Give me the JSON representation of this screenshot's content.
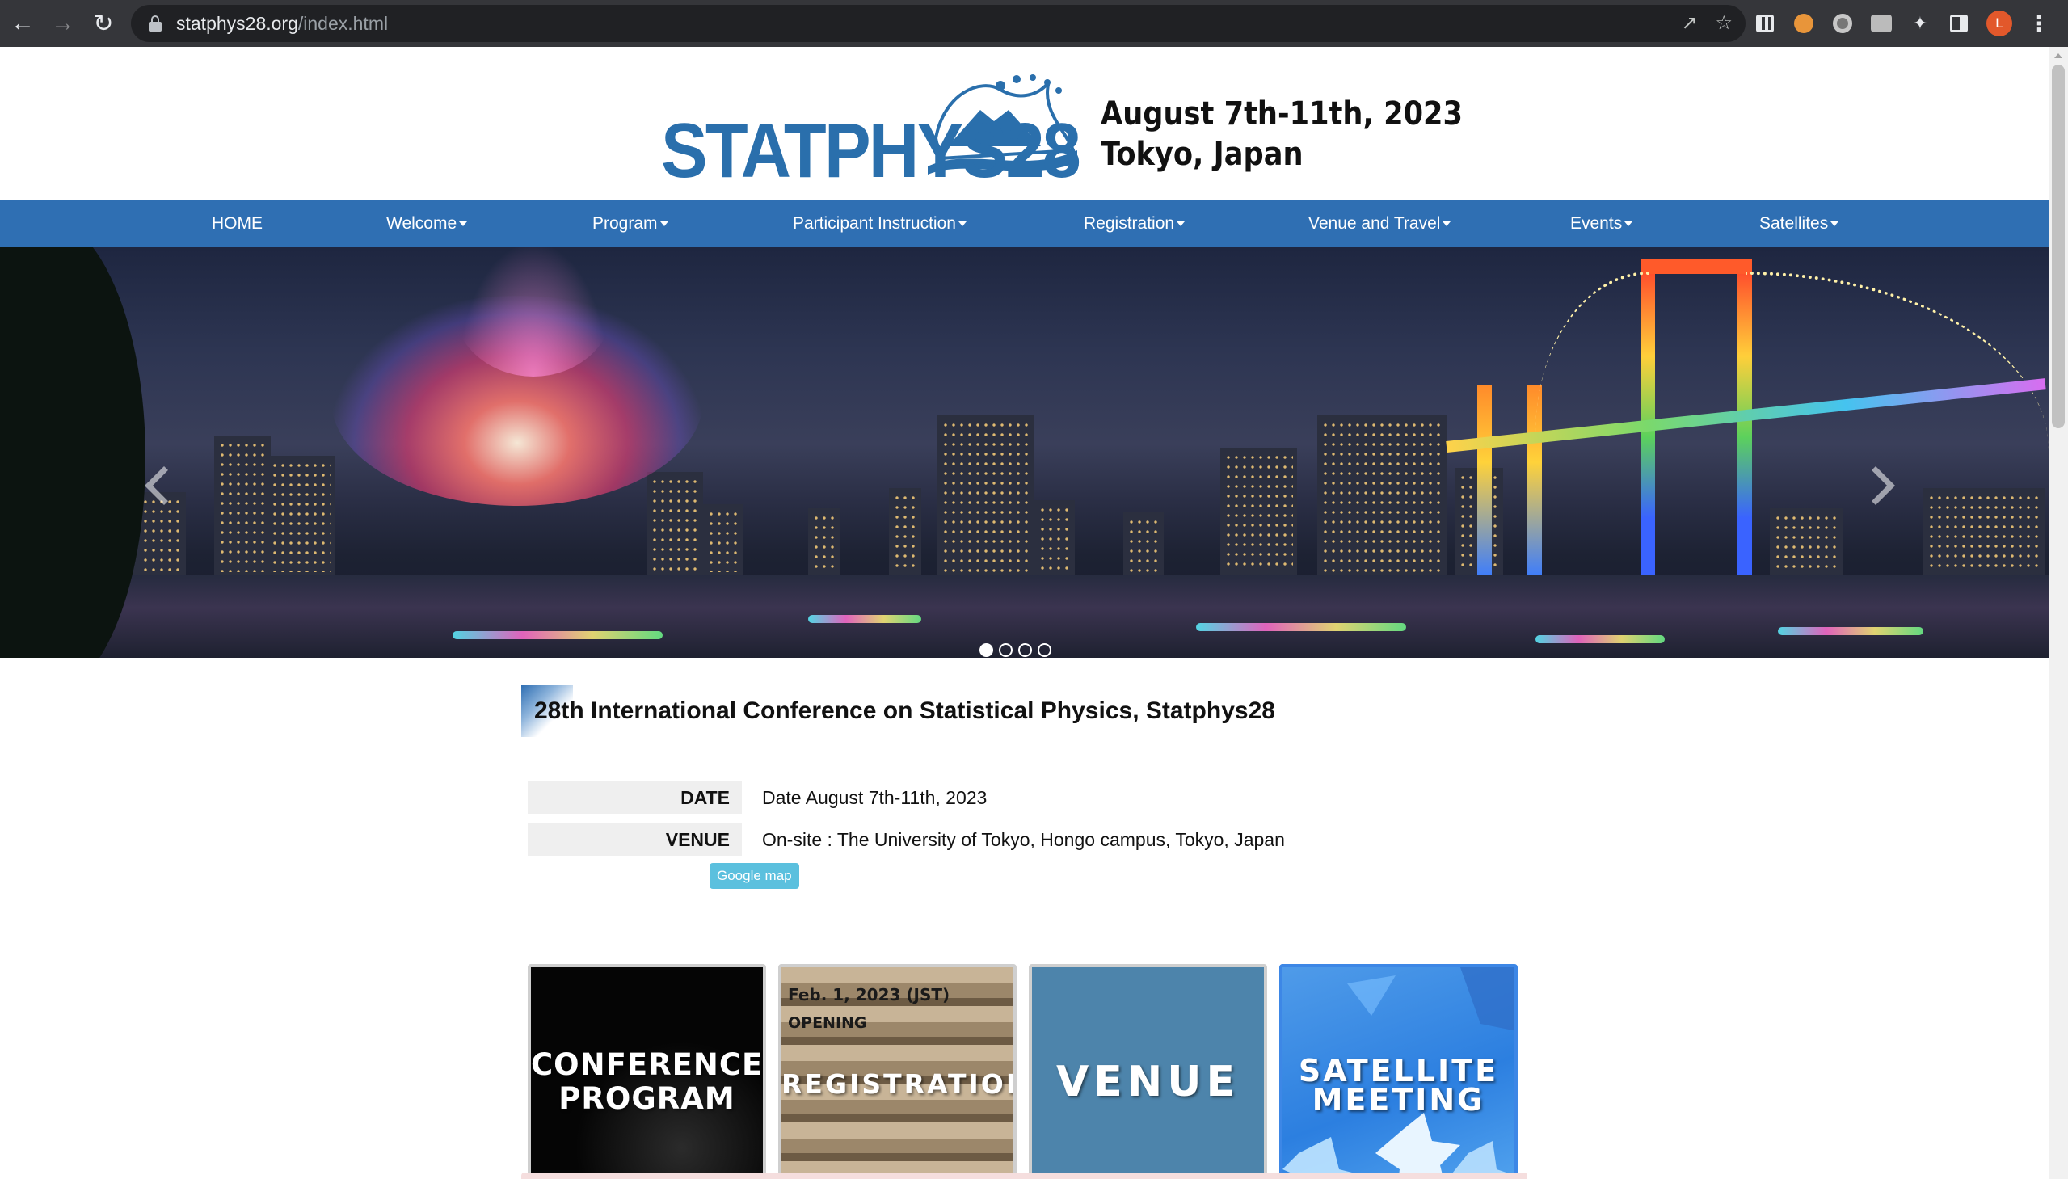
{
  "browser": {
    "url_host": "statphys28.org",
    "url_path": "/index.html",
    "avatar_letter": "L"
  },
  "header": {
    "logo_text": "STATPHYS28",
    "date_line": "August 7th-11th, 2023",
    "place_line": "Tokyo, Japan"
  },
  "nav": [
    {
      "label": "HOME"
    },
    {
      "label": "Welcome"
    },
    {
      "label": "Program"
    },
    {
      "label": "Participant Instruction"
    },
    {
      "label": "Registration"
    },
    {
      "label": "Venue and Travel"
    },
    {
      "label": "Events"
    },
    {
      "label": "Satellites"
    }
  ],
  "carousel": {
    "slides": 4,
    "active_slide": 1
  },
  "main": {
    "title": "28th International Conference on Statistical Physics, Statphys28",
    "date_label": "DATE",
    "date_value": "Date August 7th-11th, 2023",
    "venue_label": "VENUE",
    "venue_value": "On-site : The University of Tokyo, Hongo campus, Tokyo, Japan",
    "google_map": "Google map"
  },
  "tiles": {
    "program_line1": "CONFERENCE",
    "program_line2": "PROGRAM",
    "registration_date": "Feb. 1, 2023 (JST)",
    "registration_opening": "OPENING",
    "registration_label": "REGISTRATION",
    "venue_label": "VENUE",
    "satellite_line1": "SATELLITE",
    "satellite_line2": "MEETING"
  },
  "colors": {
    "nav_blue": "#2f6fb3",
    "logo_blue": "#2a6fac",
    "map_button": "#5bc0de",
    "chrome_dark": "#35363a"
  }
}
